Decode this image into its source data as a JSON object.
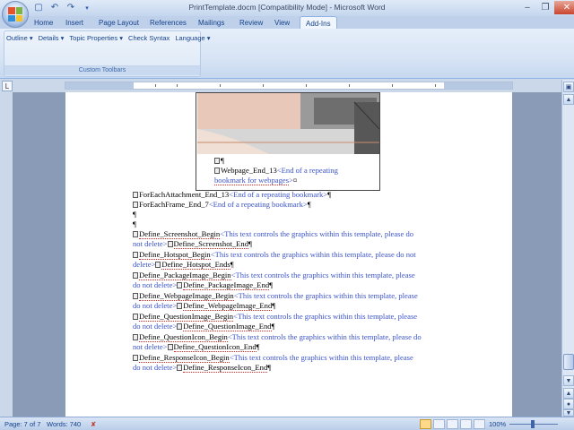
{
  "window": {
    "title": "PrintTemplate.docm [Compatibility Mode] - Microsoft Word"
  },
  "ribbon": {
    "tabs": [
      {
        "label": "Home",
        "active": false
      },
      {
        "label": "Insert",
        "active": false
      },
      {
        "label": "Page Layout",
        "active": false
      },
      {
        "label": "References",
        "active": false
      },
      {
        "label": "Mailings",
        "active": false
      },
      {
        "label": "Review",
        "active": false
      },
      {
        "label": "View",
        "active": false
      },
      {
        "label": "Add-Ins",
        "active": true
      }
    ],
    "menu_items": [
      "Outline ▾",
      "Details ▾",
      "Topic Properties ▾",
      "Check Syntax",
      "Language ▾"
    ],
    "group_label": "Custom Toolbars"
  },
  "document": {
    "image_caption_line1": "Webpage_End_13",
    "image_caption_blue1": "<End of a repeating",
    "image_caption_line2": "bookmark for webpages",
    "lines": [
      {
        "black": "ForEachAttachment_End_13",
        "blue": "<End of a repeating bookmark>",
        "end": "¶"
      },
      {
        "black": "ForEachFrame_End_7",
        "blue": "<End of a repeating bookmark>",
        "end": "¶"
      }
    ],
    "pilcrow": "¶",
    "defines": [
      {
        "begin": "Define_Screenshot_Begin",
        "note1": "<This text controls the graphics within this template, please do",
        "note2": "not delete>",
        "end": "Define_Screenshot_End"
      },
      {
        "begin": "Define_Hotspot_Begin",
        "note1": "<This text controls the graphics within this template, please do not",
        "note2": "delete>",
        "end": "Define_Hotspot_Ends"
      },
      {
        "begin": "Define_PackageImage_Begin",
        "note1": "<This text controls the graphics within this template, please",
        "note2": "do not delete>",
        "end": "Define_PackageImage_End"
      },
      {
        "begin": "Define_WebpageImage_Begin",
        "note1": "<This text controls the graphics within this template, please",
        "note2": "do not delete>",
        "end": "Define_WebpageImage_End"
      },
      {
        "begin": "Define_QuestionImage_Begin",
        "note1": "<This text controls the graphics within this template, please",
        "note2": "do not delete>",
        "end": "Define_QuestionImage_End"
      },
      {
        "begin": "Define_QuestionIcon_Begin",
        "note1": "<This text controls the graphics within this template, please do",
        "note2": "not delete>",
        "end": "Define_QuestionIcon_End"
      },
      {
        "begin": "Define_ResponseIcon_Begin",
        "note1": "<This text controls the graphics within this template, please",
        "note2": "do not delete>",
        "end": "Define_ResponseIcon_End"
      }
    ]
  },
  "status": {
    "page": "Page: 7 of 7",
    "words": "Words: 740",
    "zoom": "100%"
  },
  "colors": {
    "accent": "#15428b",
    "note_blue": "#3a52c9"
  }
}
